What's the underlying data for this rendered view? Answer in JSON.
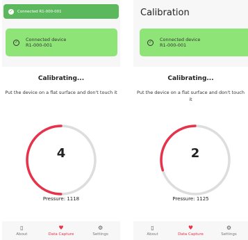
{
  "colors": {
    "toast_bg": "#5cb85c",
    "device_card_bg": "#8fe478",
    "progress_arc": "#e8314a",
    "progress_track": "#dddddd",
    "active_nav": "#e8314a"
  },
  "left": {
    "toast": {
      "text": "Connected R1-000-001",
      "icon": "check-circle-icon"
    },
    "device": {
      "status": "Connected device",
      "id": "R1-000-001",
      "icon": "check-circle-icon"
    },
    "calibration": {
      "title": "Calibrating...",
      "instruction": "Put the device on a flat surface and don't touch it",
      "countdown": "4",
      "progress_fraction": 0.5,
      "pressure": "Pressure: 1118"
    }
  },
  "right": {
    "header_title": "Calibration",
    "device": {
      "status": "Connected device",
      "id": "R1-000-001",
      "icon": "check-circle-icon"
    },
    "calibration": {
      "title": "Calibrating...",
      "instruction": "Put the device on a flat surface and don't touch it",
      "countdown": "2",
      "progress_fraction": 0.3,
      "pressure": "Pressure: 1125"
    }
  },
  "nav": [
    {
      "label": "About",
      "icon": "document-icon"
    },
    {
      "label": "Data Capture",
      "icon": "heart-icon",
      "active": true
    },
    {
      "label": "Settings",
      "icon": "gear-icon"
    }
  ]
}
